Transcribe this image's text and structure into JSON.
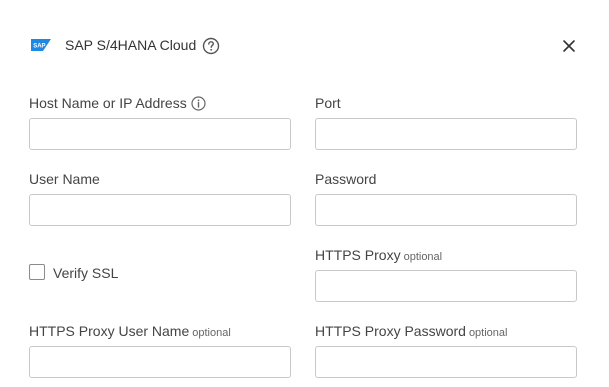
{
  "dialog": {
    "title": "SAP S/4HANA Cloud",
    "logo_text": "SAP"
  },
  "fields": {
    "host": {
      "label": "Host Name or IP Address",
      "value": ""
    },
    "port": {
      "label": "Port",
      "value": ""
    },
    "username": {
      "label": "User Name",
      "value": ""
    },
    "password": {
      "label": "Password",
      "value": ""
    },
    "verify_ssl": {
      "label": "Verify SSL",
      "checked": false
    },
    "https_proxy": {
      "label": "HTTPS Proxy",
      "optional": "optional",
      "value": ""
    },
    "proxy_username": {
      "label": "HTTPS Proxy User Name",
      "optional": "optional",
      "value": ""
    },
    "proxy_password": {
      "label": "HTTPS Proxy Password",
      "optional": "optional",
      "value": ""
    }
  },
  "colors": {
    "sap_blue": "#1e88e5",
    "border": "#c9c9c9",
    "text": "#444444"
  },
  "icons": [
    "sap-logo",
    "help-circle-icon",
    "close-icon",
    "info-icon"
  ]
}
